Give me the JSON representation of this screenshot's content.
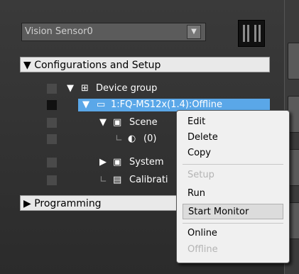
{
  "sensor_select": {
    "value": "Vision Sensor0"
  },
  "sections": {
    "configurations": "▼ Configurations and Setup",
    "programming": "▶ Programming"
  },
  "tree": {
    "device_group": "Device group",
    "device": "1:FQ-MS12x(1.4):Offline",
    "scene": "Scene",
    "scene_child": "(0)",
    "system": "System",
    "calibration": "Calibrati"
  },
  "context_menu": {
    "edit": "Edit",
    "delete": "Delete",
    "copy": "Copy",
    "setup": "Setup",
    "run": "Run",
    "start_monitor": "Start Monitor",
    "online": "Online",
    "offline": "Offline"
  },
  "colors": {
    "selection": "#5aa7e8",
    "menu_bg": "#f0f0f0",
    "panel_bg": "#2e2e2e"
  }
}
